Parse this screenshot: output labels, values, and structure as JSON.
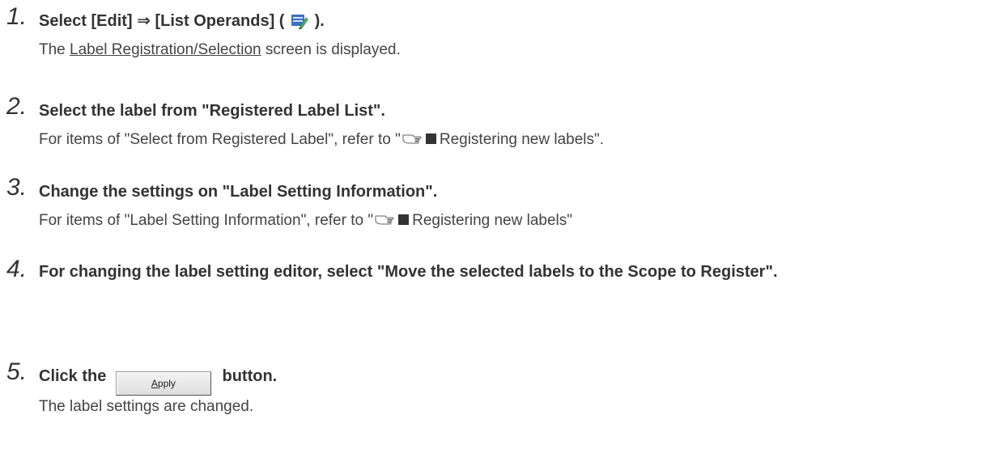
{
  "steps": [
    {
      "number": "1.",
      "title_pre": "Select [Edit] ⇒ [List Operands] (",
      "title_icon": "list-operands-icon",
      "title_post": ").",
      "body_pre": "The ",
      "body_link": "Label Registration/Selection",
      "body_post": " screen is displayed."
    },
    {
      "number": "2.",
      "title": "Select the label from \"Registered Label List\".",
      "body_pre": "For items of \"Select from Registered Label\", refer to \"",
      "body_ref_icon": "reference-hand-icon",
      "body_square_icon": "black-square-icon",
      "body_post": "Registering new labels\"."
    },
    {
      "number": "3.",
      "title": "Change the settings on \"Label Setting Information\".",
      "body_pre": "For items of \"Label Setting Information\", refer to \"",
      "body_ref_icon": "reference-hand-icon",
      "body_square_icon": "black-square-icon",
      "body_post": "Registering new labels\""
    },
    {
      "number": "4.",
      "title": "For changing the label setting editor, select \"Move the selected labels to the Scope to Register\"."
    },
    {
      "number": "5.",
      "title_pre": "Click the",
      "button_label_accel": "A",
      "button_label_rest": "pply",
      "title_post": "button.",
      "body": "The label settings are changed."
    }
  ]
}
